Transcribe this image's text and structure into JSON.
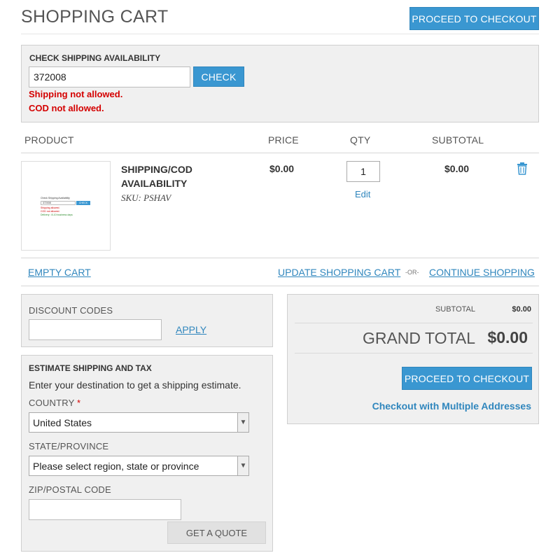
{
  "page": {
    "title": "SHOPPING CART",
    "proceed_top_label": "PROCEED TO CHECKOUT"
  },
  "shipping_check": {
    "title": "CHECK SHIPPING AVAILABILITY",
    "pincode_value": "372008",
    "check_label": "CHECK",
    "message_shipping": "Shipping not allowed.",
    "message_cod": "COD not allowed."
  },
  "table": {
    "headers": {
      "product": "PRODUCT",
      "price": "PRICE",
      "qty": "QTY",
      "subtotal": "SUBTOTAL"
    }
  },
  "item": {
    "name": "SHIPPING/COD AVAILABILITY",
    "sku": "SKU: PSHAV",
    "price": "$0.00",
    "qty": "1",
    "edit_label": "Edit",
    "subtotal": "$0.00",
    "delete_icon": "trash-icon",
    "thumbnail": {
      "title": "Check Shipping Availability",
      "input_value": "372008",
      "button": "CHECK",
      "line1": "Shipping allowed.",
      "line2": "COD not allowed.",
      "line3": "Delivery : 8-10 business days"
    }
  },
  "actions": {
    "empty_cart": "EMPTY CART",
    "update_cart": "UPDATE SHOPPING CART",
    "or": "-OR-",
    "continue": "CONTINUE SHOPPING"
  },
  "discount": {
    "title": "DISCOUNT CODES",
    "apply_label": "APPLY",
    "input_value": ""
  },
  "estimate": {
    "title": "ESTIMATE SHIPPING AND TAX",
    "description": "Enter your destination to get a shipping estimate.",
    "country_label": "COUNTRY",
    "required_mark": "*",
    "country_value": "United States",
    "state_label": "STATE/PROVINCE",
    "state_value": "Please select region, state or province",
    "zip_label": "ZIP/POSTAL CODE",
    "zip_value": "",
    "quote_label": "GET A QUOTE"
  },
  "summary": {
    "subtotal_label": "SUBTOTAL",
    "subtotal_value": "$0.00",
    "grand_total_label": "GRAND TOTAL",
    "grand_total_value": "$0.00",
    "checkout_label": "PROCEED TO CHECKOUT",
    "multi_address_label": "Checkout with Multiple Addresses"
  },
  "colors": {
    "accent": "#3a97d1",
    "error": "#d40000",
    "panel": "#f0f0f0"
  }
}
